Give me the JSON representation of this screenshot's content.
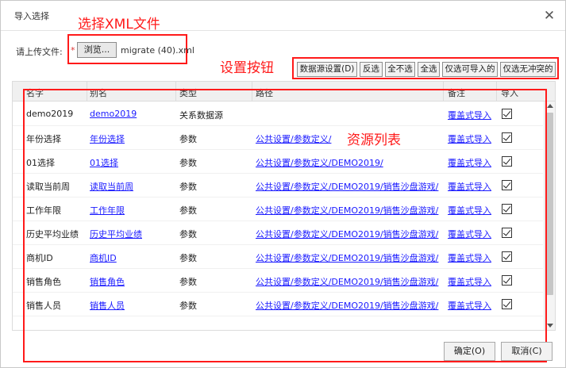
{
  "dialog": {
    "title": "导入选择",
    "close_glyph": "✕"
  },
  "annotations": {
    "select_xml": "选择XML文件",
    "set_buttons": "设置按钮",
    "resource_list": "资源列表"
  },
  "upload": {
    "label": "请上传文件:",
    "required_mark": "*",
    "browse_label": "浏览...",
    "filename": "migrate (40).xml"
  },
  "toolbar": {
    "datasource": "数据源设置(D)",
    "invert": "反选",
    "select_none": "全不选",
    "select_all": "全选",
    "select_importable": "仅选可导入的",
    "select_no_conflict": "仅选无冲突的"
  },
  "table": {
    "headers": [
      "名字",
      "别名",
      "类型",
      "路径",
      "备注",
      "导入"
    ],
    "rows": [
      {
        "name": "demo2019",
        "alias": "demo2019",
        "type": "关系数据源",
        "path": "",
        "remark": "覆盖式导入",
        "checked": true
      },
      {
        "name": "年份选择",
        "alias": "年份选择",
        "type": "参数",
        "path": "公共设置/参数定义/",
        "remark": "覆盖式导入",
        "checked": true
      },
      {
        "name": "01选择",
        "alias": "01选择",
        "type": "参数",
        "path": "公共设置/参数定义/DEMO2019/",
        "remark": "覆盖式导入",
        "checked": true
      },
      {
        "name": "读取当前周",
        "alias": "读取当前周",
        "type": "参数",
        "path": "公共设置/参数定义/DEMO2019/销售沙盘游戏/",
        "remark": "覆盖式导入",
        "checked": true
      },
      {
        "name": "工作年限",
        "alias": "工作年限",
        "type": "参数",
        "path": "公共设置/参数定义/DEMO2019/销售沙盘游戏/",
        "remark": "覆盖式导入",
        "checked": true
      },
      {
        "name": "历史平均业绩",
        "alias": "历史平均业绩",
        "type": "参数",
        "path": "公共设置/参数定义/DEMO2019/销售沙盘游戏/",
        "remark": "覆盖式导入",
        "checked": true
      },
      {
        "name": "商机ID",
        "alias": "商机ID",
        "type": "参数",
        "path": "公共设置/参数定义/DEMO2019/销售沙盘游戏/",
        "remark": "覆盖式导入",
        "checked": true
      },
      {
        "name": "销售角色",
        "alias": "销售角色",
        "type": "参数",
        "path": "公共设置/参数定义/DEMO2019/销售沙盘游戏/",
        "remark": "覆盖式导入",
        "checked": true
      },
      {
        "name": "销售人员",
        "alias": "销售人员",
        "type": "参数",
        "path": "公共设置/参数定义/DEMO2019/销售沙盘游戏/",
        "remark": "覆盖式导入",
        "checked": true
      }
    ]
  },
  "footer": {
    "ok": "确定(O)",
    "cancel": "取消(C)"
  }
}
